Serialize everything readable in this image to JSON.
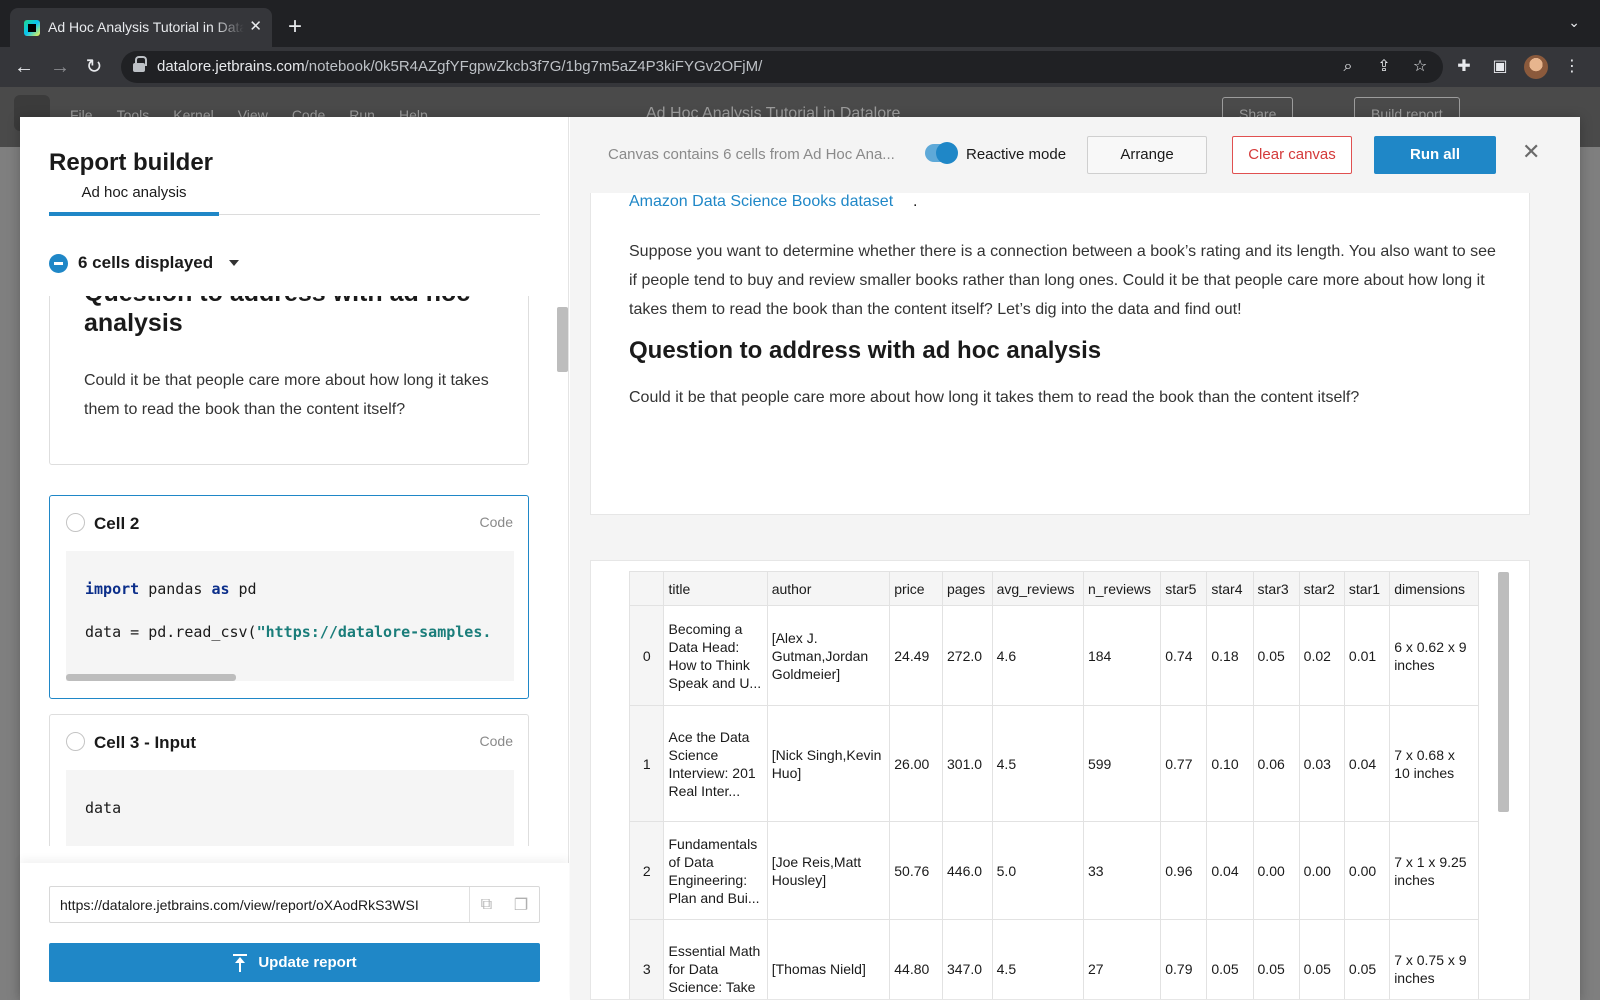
{
  "browser": {
    "tab_title": "Ad Hoc Analysis Tutorial in Datalore",
    "tab_close": "✕",
    "new_tab": "+",
    "url_host": "datalore.jetbrains.com",
    "url_path": "/notebook/0k5R4AZgfYFgpwZkcb3f7G/1bg7m5aZ4P3kiFYGv2OFjM/"
  },
  "app": {
    "menu": [
      "File",
      "Tools",
      "Kernel",
      "View",
      "Code",
      "Run",
      "Help"
    ],
    "title": "Ad Hoc Analysis Tutorial in Datalore",
    "share_label": "Share",
    "build_report_label": "Build report"
  },
  "report_builder": {
    "title": "Report builder",
    "tab_label": "Ad hoc analysis",
    "cells_displayed": "6 cells displayed",
    "cell1": {
      "heading": "Question to address with ad hoc analysis",
      "text": "Could it be that people care more about how long it takes them to read the book than the content itself?"
    },
    "cell2": {
      "name": "Cell 2",
      "type": "Code",
      "line1_kw1": "import",
      "line1_mid": " pandas ",
      "line1_kw2": "as",
      "line1_end": " pd",
      "line2_start": "data = pd.read_csv(",
      "line2_str": "\"https://datalore-samples."
    },
    "cell3": {
      "name": "Cell 3 - Input",
      "type": "Code",
      "code": "data"
    },
    "report_url": "https://datalore.jetbrains.com/view/report/oXAodRkS3WSI",
    "update_label": "Update report"
  },
  "canvas": {
    "info": "Canvas contains 6 cells from Ad Hoc Ana...",
    "reactive_label": "Reactive mode",
    "arrange_label": "Arrange",
    "clear_label": "Clear canvas",
    "run_all_label": "Run all",
    "close": "✕",
    "dataset_link": "Amazon Data Science Books dataset",
    "dataset_dot": ".",
    "paragraph": "Suppose you want to determine whether there is a connection between a book’s rating and its length. You also want to see if people tend to buy and review smaller books rather than long ones. Could it be that people care more about how long it takes them to read the book than the content itself? Let’s dig into the data and find out!",
    "heading": "Question to address with ad hoc analysis",
    "question": "Could it be that people care more about how long it takes them to read the book than the content itself?"
  },
  "table": {
    "columns": [
      "",
      "title",
      "author",
      "price",
      "pages",
      "avg_reviews",
      "n_reviews",
      "star5",
      "star4",
      "star3",
      "star2",
      "star1",
      "dimensions"
    ],
    "rows": [
      [
        "0",
        "Becoming a Data Head: How to Think Speak and U...",
        "[Alex J. Gutman,Jordan Goldmeier]",
        "24.49",
        "272.0",
        "4.6",
        "184",
        "0.74",
        "0.18",
        "0.05",
        "0.02",
        "0.01",
        "6 x 0.62 x 9 inches"
      ],
      [
        "1",
        "Ace the Data Science Interview: 201 Real Inter...",
        "[Nick Singh,Kevin Huo]",
        "26.00",
        "301.0",
        "4.5",
        "599",
        "0.77",
        "0.10",
        "0.06",
        "0.03",
        "0.04",
        "7 x 0.68 x 10 inches"
      ],
      [
        "2",
        "Fundamentals of Data Engineering: Plan and Bui...",
        "[Joe Reis,Matt Housley]",
        "50.76",
        "446.0",
        "5.0",
        "33",
        "0.96",
        "0.04",
        "0.00",
        "0.00",
        "0.00",
        "7 x 1 x 9.25 inches"
      ],
      [
        "3",
        "Essential Math for Data Science: Take",
        "[Thomas Nield]",
        "44.80",
        "347.0",
        "4.5",
        "27",
        "0.79",
        "0.05",
        "0.05",
        "0.05",
        "0.05",
        "7 x 0.75 x 9 inches"
      ]
    ]
  }
}
